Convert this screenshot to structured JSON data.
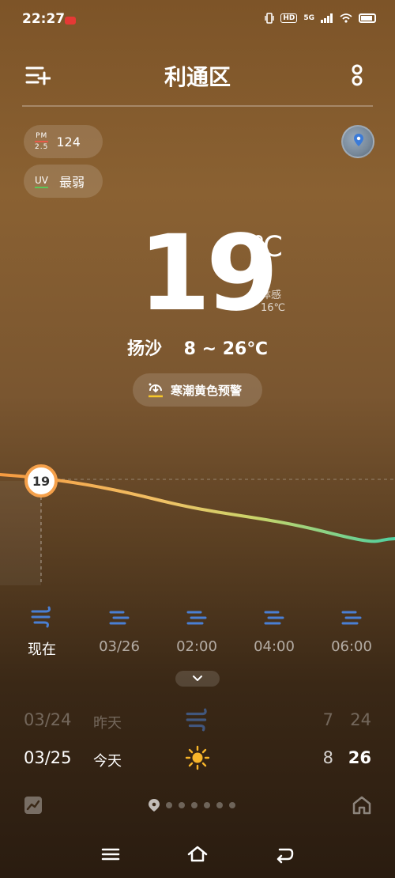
{
  "status": {
    "time": "22:27",
    "hd": "HD",
    "network": "5G"
  },
  "header": {
    "title": "利通区"
  },
  "air": {
    "pm_label_top": "PM",
    "pm_label_bottom": "2.5",
    "pm_value": "124",
    "uv_label": "UV",
    "uv_value": "最弱"
  },
  "current": {
    "temperature": "19",
    "unit": "℃",
    "feels_like_label": "体感",
    "feels_like_value": "16℃",
    "condition": "扬沙",
    "range": "8 ~ 26℃",
    "alert": "寒潮黄色预警"
  },
  "curve": {
    "current_value": "19"
  },
  "hourly": [
    {
      "label": "现在",
      "icon": "sandstorm-icon"
    },
    {
      "label": "03/26",
      "icon": "haze-icon"
    },
    {
      "label": "02:00",
      "icon": "haze-icon"
    },
    {
      "label": "04:00",
      "icon": "haze-icon"
    },
    {
      "label": "06:00",
      "icon": "haze-icon"
    }
  ],
  "daily": [
    {
      "date": "03/24",
      "name": "昨天",
      "icon": "sandstorm-icon",
      "low": "7",
      "high": "24"
    },
    {
      "date": "03/25",
      "name": "今天",
      "icon": "sun-icon",
      "low": "8",
      "high": "26"
    }
  ],
  "colors": {
    "accent_orange": "#f5a04a",
    "curve_green": "#4fd0a0",
    "sun_yellow": "#f7b52a",
    "icon_blue": "#4a7fd4"
  }
}
